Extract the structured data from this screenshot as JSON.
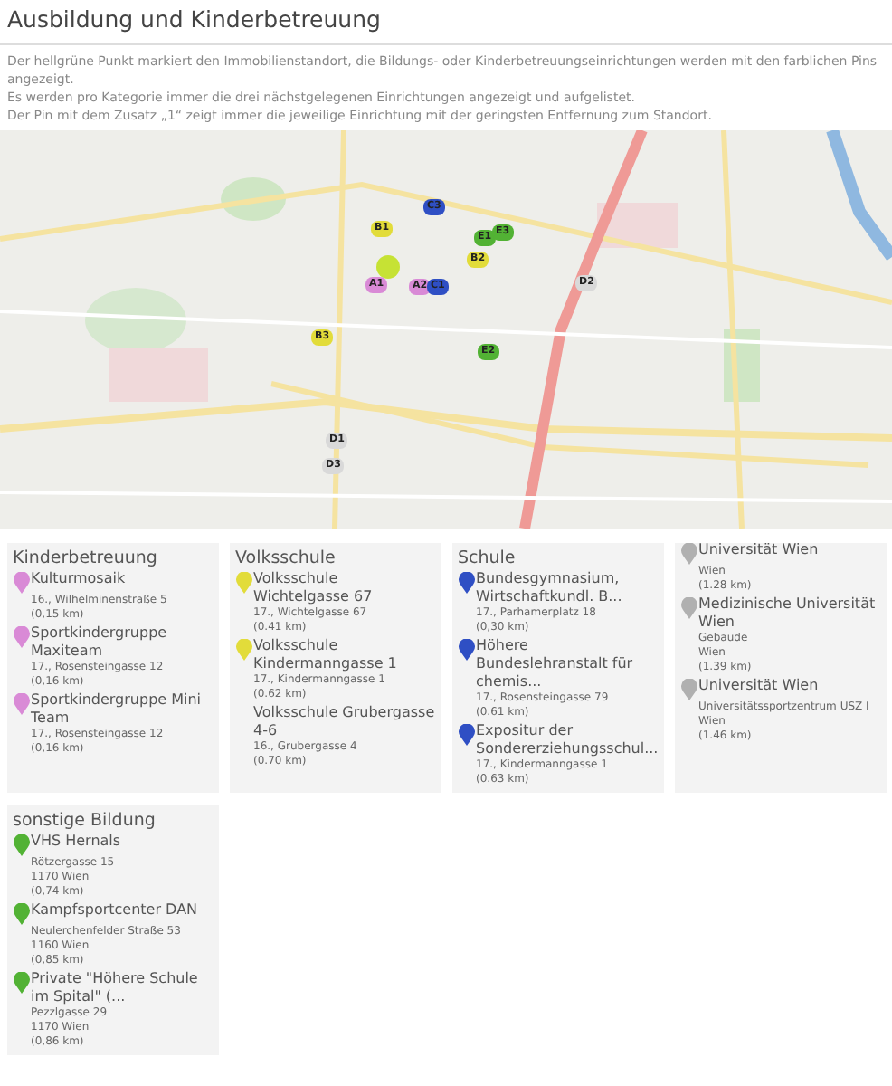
{
  "title": "Ausbildung und Kinderbetreuung",
  "intro": [
    "Der hellgrüne Punkt markiert den Immobilienstandort, die Bildungs- oder Kinderbetreuungseinrichtungen werden mit den farblichen Pins angezeigt.",
    "Es werden pro Kategorie immer die drei nächstgelegenen Einrichtungen angezeigt und aufgelistet.",
    "Der Pin mit dem Zusatz „1“ zeigt immer die jeweilige Einrichtung mit der geringsten Entfernung zum Standort."
  ],
  "map": {
    "kind": "picture",
    "pins": [
      {
        "label": "B1",
        "color": "#e2dc3a"
      },
      {
        "label": "C3",
        "color": "#2f4fc4"
      },
      {
        "label": "E1",
        "color": "#52b234"
      },
      {
        "label": "E3",
        "color": "#52b234"
      },
      {
        "label": "B2",
        "color": "#e2dc3a"
      },
      {
        "label": "A1",
        "color": "#d98ad6"
      },
      {
        "label": "A2",
        "color": "#d98ad6"
      },
      {
        "label": "C1",
        "color": "#2f4fc4"
      },
      {
        "label": "D2",
        "color": "#d9d9d9"
      },
      {
        "label": "B3",
        "color": "#e2dc3a"
      },
      {
        "label": "E2",
        "color": "#52b234"
      },
      {
        "label": "D1",
        "color": "#d9d9d9"
      },
      {
        "label": "D3",
        "color": "#d9d9d9"
      }
    ]
  },
  "categories": [
    {
      "heading": "Kinderbetreuung",
      "items": [
        {
          "name": "Kulturmosaik",
          "color": "#d98ad6",
          "details": [
            "16., Wilhelminenstraße 5",
            "(0,15 km)"
          ]
        },
        {
          "name": "Sportkindergruppe Maxiteam",
          "color": "#d98ad6",
          "details": [
            "17., Rosensteingasse 12",
            "(0,16 km)"
          ]
        },
        {
          "name": "Sportkindergruppe Mini Team",
          "color": "#d98ad6",
          "details": [
            "17., Rosensteingasse 12",
            "(0,16 km)"
          ]
        }
      ]
    },
    {
      "heading": "Volksschule",
      "items": [
        {
          "name": "Volksschule Wichtelgasse 67",
          "color": "#e2dc3a",
          "details": [
            "17., Wichtelgasse 67",
            "(0.41 km)"
          ]
        },
        {
          "name": "Volksschule Kindermanngasse 1",
          "color": "#e2dc3a",
          "details": [
            "17., Kindermanngasse 1",
            "(0.62 km)"
          ]
        },
        {
          "name": "Volksschule Grubergasse 4-6",
          "details": [
            "16., Grubergasse 4",
            "(0.70 km)"
          ]
        }
      ]
    },
    {
      "heading": "Schule",
      "items": [
        {
          "name": "Bundesgymnasium, Wirtschaftkundl. B...",
          "color": "#2f4fc4",
          "details": [
            "17., Parhamerplatz 18",
            "(0,30 km)"
          ]
        },
        {
          "name": "Höhere Bundeslehranstalt für chemis...",
          "color": "#2f4fc4",
          "details": [
            "17., Rosensteingasse 79",
            "(0.61 km)"
          ]
        },
        {
          "name": "Expositur der Sondererziehungsschul...",
          "color": "#2f4fc4",
          "details": [
            "17., Kindermanngasse 1",
            "(0.63 km)"
          ]
        }
      ]
    },
    {
      "items": [
        {
          "name": "Universität Wien",
          "color": "#b0b0b0",
          "clipped": true,
          "details": [
            "Wien",
            "(1.28 km)"
          ]
        },
        {
          "name": "Medizinische Universität Wien",
          "color": "#b0b0b0",
          "details": [
            "Gebäude",
            "Wien",
            "(1.39 km)"
          ]
        },
        {
          "name": "Universität Wien",
          "color": "#b0b0b0",
          "details": [
            "Universitätssportzentrum USZ I",
            "Wien",
            "(1.46 km)"
          ]
        }
      ]
    },
    {
      "heading": "sonstige Bildung",
      "items": [
        {
          "name": "VHS Hernals",
          "color": "#52b234",
          "details": [
            "Rötzergasse 15",
            "1170 Wien",
            "(0,74 km)"
          ]
        },
        {
          "name": "Kampfsportcenter DAN",
          "color": "#52b234",
          "details": [
            "Neulerchenfelder Straße 53",
            "1160 Wien",
            "(0,85 km)"
          ]
        },
        {
          "name": "Private \"Höhere Schule im Spital\" (...",
          "color": "#52b234",
          "details": [
            "Pezzlgasse 29",
            "1170 Wien",
            "(0,86 km)"
          ]
        }
      ]
    }
  ]
}
